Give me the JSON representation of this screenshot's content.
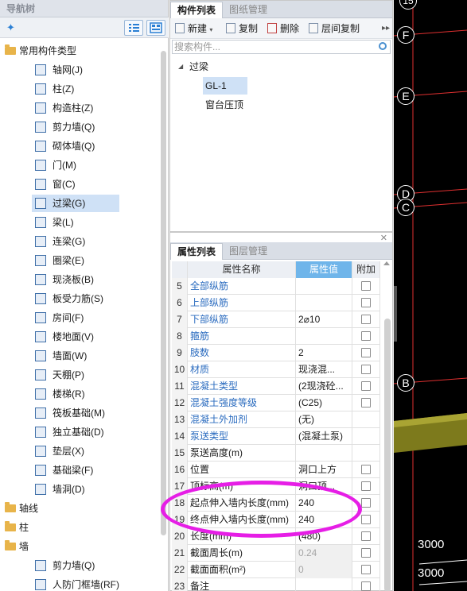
{
  "nav": {
    "title": "导航树",
    "items": [
      {
        "label": "常用构件类型",
        "level": 0
      },
      {
        "label": "轴网(J)",
        "level": 1
      },
      {
        "label": "柱(Z)",
        "level": 1
      },
      {
        "label": "构造柱(Z)",
        "level": 1
      },
      {
        "label": "剪力墙(Q)",
        "level": 1
      },
      {
        "label": "砌体墙(Q)",
        "level": 1
      },
      {
        "label": "门(M)",
        "level": 1
      },
      {
        "label": "窗(C)",
        "level": 1
      },
      {
        "label": "过梁(G)",
        "level": 1,
        "selected": true
      },
      {
        "label": "梁(L)",
        "level": 1
      },
      {
        "label": "连梁(G)",
        "level": 1
      },
      {
        "label": "圈梁(E)",
        "level": 1
      },
      {
        "label": "现浇板(B)",
        "level": 1
      },
      {
        "label": "板受力筋(S)",
        "level": 1
      },
      {
        "label": "房间(F)",
        "level": 1
      },
      {
        "label": "楼地面(V)",
        "level": 1
      },
      {
        "label": "墙面(W)",
        "level": 1
      },
      {
        "label": "天棚(P)",
        "level": 1
      },
      {
        "label": "楼梯(R)",
        "level": 1
      },
      {
        "label": "筏板基础(M)",
        "level": 1
      },
      {
        "label": "独立基础(D)",
        "level": 1
      },
      {
        "label": "垫层(X)",
        "level": 1
      },
      {
        "label": "基础梁(F)",
        "level": 1
      },
      {
        "label": "墙洞(D)",
        "level": 1
      },
      {
        "label": "轴线",
        "level": 0
      },
      {
        "label": "柱",
        "level": 0
      },
      {
        "label": "墙",
        "level": 0
      },
      {
        "label": "剪力墙(Q)",
        "level": 1
      },
      {
        "label": "人防门框墙(RF)",
        "level": 1
      }
    ]
  },
  "components": {
    "tabs": [
      "构件列表",
      "图纸管理"
    ],
    "toolbar": {
      "new": "新建",
      "copy": "复制",
      "delete": "删除",
      "floor_copy": "层间复制"
    },
    "search_placeholder": "搜索构件...",
    "tree": {
      "group": "过梁",
      "items": [
        "GL-1",
        "窗台压顶"
      ],
      "selected": "GL-1"
    }
  },
  "properties": {
    "tabs": [
      "属性列表",
      "图层管理"
    ],
    "columns": {
      "name": "属性名称",
      "value": "属性值",
      "extra": "附加"
    },
    "rows": [
      {
        "num": "5",
        "name": "全部纵筋",
        "value": "",
        "blue": true,
        "check": true
      },
      {
        "num": "6",
        "name": "上部纵筋",
        "value": "",
        "blue": true,
        "check": true
      },
      {
        "num": "7",
        "name": "下部纵筋",
        "value": "2⌀10",
        "blue": true,
        "check": true
      },
      {
        "num": "8",
        "name": "箍筋",
        "value": "",
        "blue": true,
        "check": true
      },
      {
        "num": "9",
        "name": "肢数",
        "value": "2",
        "blue": true,
        "check": true
      },
      {
        "num": "10",
        "name": "材质",
        "value": "现浇混...",
        "blue": true,
        "check": true
      },
      {
        "num": "11",
        "name": "混凝土类型",
        "value": "(2现浇砼...",
        "blue": true,
        "check": true
      },
      {
        "num": "12",
        "name": "混凝土强度等级",
        "value": "(C25)",
        "blue": true,
        "check": true
      },
      {
        "num": "13",
        "name": "混凝土外加剂",
        "value": "(无)",
        "blue": true,
        "check": false
      },
      {
        "num": "14",
        "name": "泵送类型",
        "value": "(混凝土泵)",
        "blue": true,
        "check": false
      },
      {
        "num": "15",
        "name": "泵送高度(m)",
        "value": "",
        "blue": false,
        "check": false
      },
      {
        "num": "16",
        "name": "位置",
        "value": "洞口上方",
        "blue": false,
        "check": true
      },
      {
        "num": "17",
        "name": "顶标高(m)",
        "value": "洞口顶...",
        "blue": false,
        "check": true
      },
      {
        "num": "18",
        "name": "起点伸入墙内长度(mm)",
        "value": "240",
        "blue": false,
        "check": true
      },
      {
        "num": "19",
        "name": "终点伸入墙内长度(mm)",
        "value": "240",
        "blue": false,
        "check": true
      },
      {
        "num": "20",
        "name": "长度(mm)",
        "value": "(480)",
        "blue": false,
        "check": true
      },
      {
        "num": "21",
        "name": "截面周长(m)",
        "value": "0.24",
        "blue": false,
        "check": true,
        "gray": true
      },
      {
        "num": "22",
        "name": "截面面积(m²)",
        "value": "0",
        "blue": false,
        "check": true,
        "gray": true
      },
      {
        "num": "23",
        "name": "备注",
        "value": "",
        "blue": false,
        "check": true
      }
    ]
  },
  "canvas": {
    "axis_labels": [
      "15",
      "F",
      "E",
      "D",
      "C",
      "B"
    ],
    "dimensions": [
      "3000",
      "3000"
    ],
    "background": "#000000",
    "grid_color": "#e03030",
    "beam_color": "#8a8a1e"
  },
  "colors": {
    "selected_row": "#cfe1f6",
    "value_header": "#6fb5ea",
    "link_blue": "#2a6bbf",
    "annotation": "#e61ee6"
  }
}
